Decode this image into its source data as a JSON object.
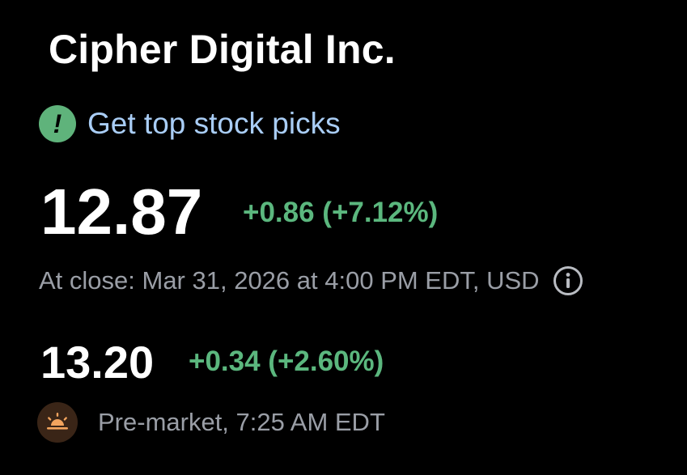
{
  "header": {
    "company_name": "Cipher Digital Inc."
  },
  "promo": {
    "icon": "exclamation-badge-icon",
    "label": "Get top stock picks"
  },
  "regular": {
    "price": "12.87",
    "change": "+0.86 (+7.12%)",
    "meta": "At close: Mar 31, 2026 at 4:00 PM EDT, USD",
    "info_icon": "info-icon"
  },
  "premarket": {
    "price": "13.20",
    "change": "+0.34 (+2.60%)",
    "icon": "sunrise-icon",
    "meta": "Pre-market, 7:25 AM EDT"
  },
  "colors": {
    "background": "#000000",
    "text_primary": "#ffffff",
    "text_secondary": "#9a9ea6",
    "positive": "#5bb77e",
    "link": "#a9cdf5",
    "promo_icon_bg": "#5fb37b",
    "sunrise_bg": "#3a2517",
    "sunrise_fg": "#f2a45e"
  }
}
